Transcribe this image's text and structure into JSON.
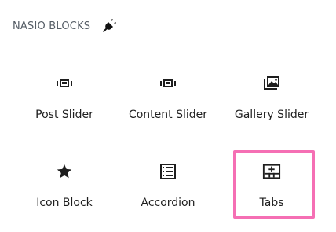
{
  "header": {
    "title": "NASIO BLOCKS",
    "icon": "plug-icon"
  },
  "blocks": [
    {
      "label": "Post Slider",
      "icon": "slider-icon"
    },
    {
      "label": "Content Slider",
      "icon": "slider-icon"
    },
    {
      "label": "Gallery Slider",
      "icon": "gallery-icon"
    },
    {
      "label": "Icon Block",
      "icon": "star-icon"
    },
    {
      "label": "Accordion",
      "icon": "list-icon"
    },
    {
      "label": "Tabs",
      "icon": "tabs-icon",
      "selected": true
    }
  ],
  "colors": {
    "selection_border": "#f56fb4",
    "text": "#1e1e1e",
    "header_text": "#555d66"
  }
}
